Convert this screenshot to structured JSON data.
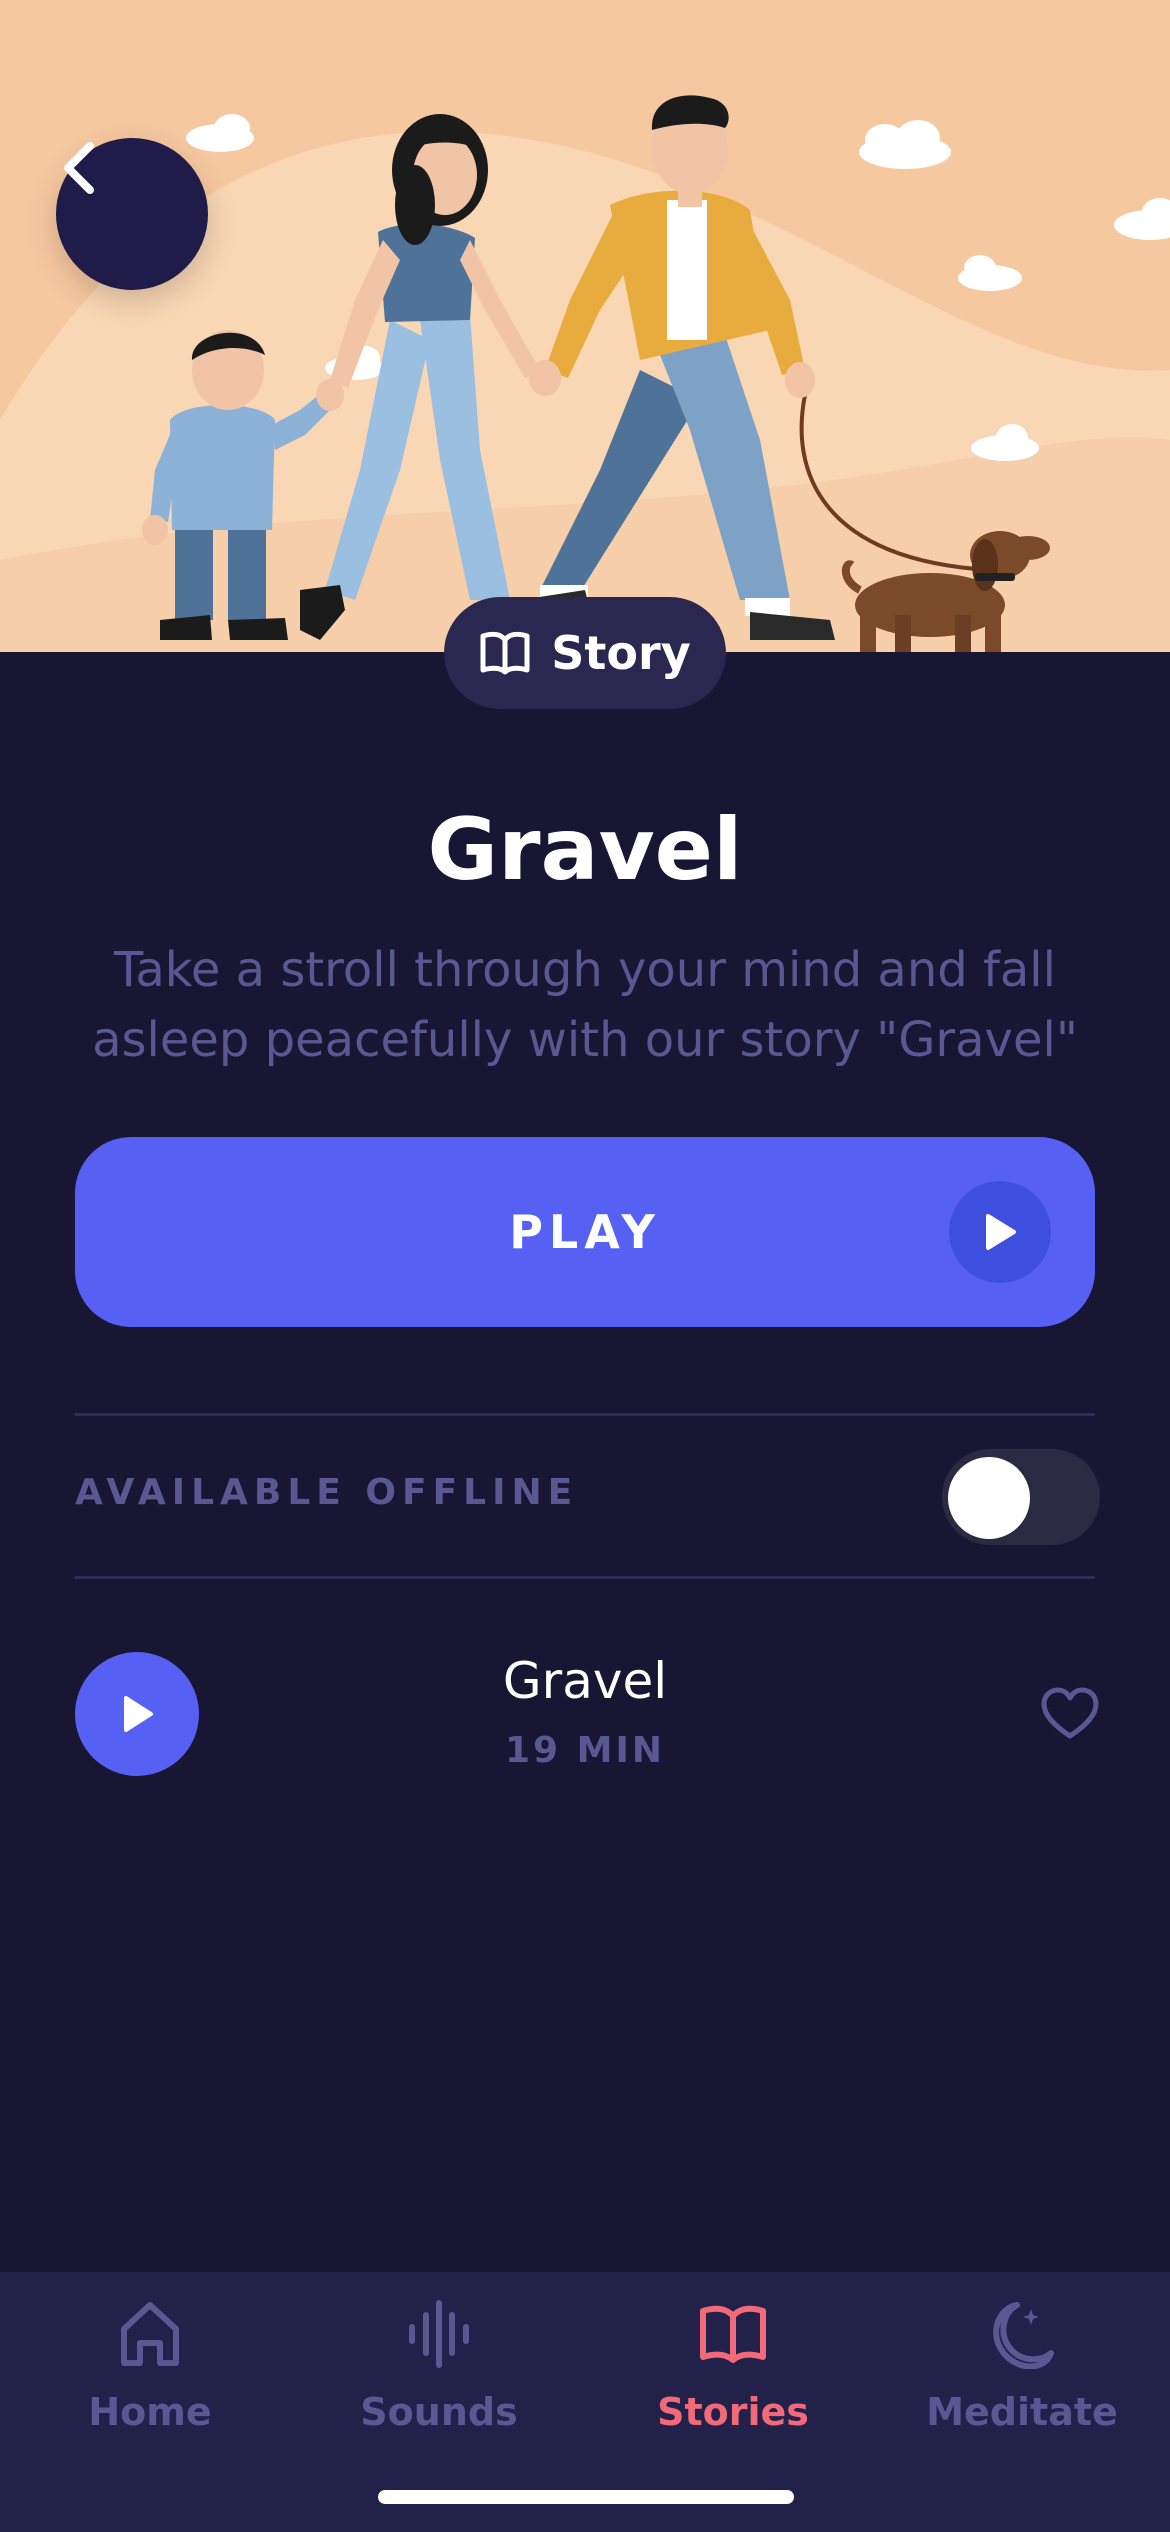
{
  "hero": {
    "image_description_icon": "family-walking-dog-illustration",
    "colors": {
      "background": "#f6c8a0",
      "hill": "#f9d6b4"
    }
  },
  "header": {
    "back_icon": "chevron-left-icon"
  },
  "content_type": {
    "icon": "book-open-icon",
    "label": "Story"
  },
  "story": {
    "title": "Gravel",
    "description": "Take a stroll through your mind and fall asleep peacefully with our story \"Gravel\""
  },
  "play_button": {
    "label": "PLAY",
    "icon": "play-icon",
    "color": "#5661f4"
  },
  "offline": {
    "label": "AVAILABLE OFFLINE",
    "enabled": false
  },
  "tracks": [
    {
      "title": "Gravel",
      "duration": "19 MIN",
      "favorite": false
    }
  ],
  "tabs": [
    {
      "label": "Home",
      "icon": "home-icon",
      "active": false
    },
    {
      "label": "Sounds",
      "icon": "sound-wave-icon",
      "active": false
    },
    {
      "label": "Stories",
      "icon": "book-open-icon",
      "active": true
    },
    {
      "label": "Meditate",
      "icon": "moon-icon",
      "active": false
    }
  ],
  "colors": {
    "background": "#181632",
    "accent": "#5661f4",
    "active_tab": "#f26a7a",
    "muted_text": "#5a5793"
  }
}
